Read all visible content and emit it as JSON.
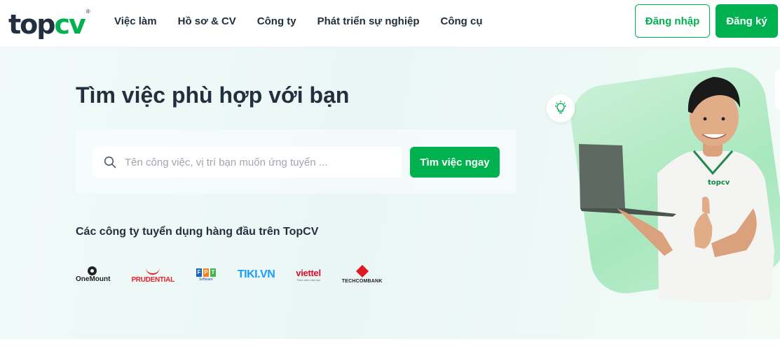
{
  "brand": {
    "logo_left": "top",
    "logo_right": "cv",
    "registered": "®",
    "accent": "#00b14f",
    "dark": "#212f3f"
  },
  "nav": {
    "items": [
      "Việc làm",
      "Hồ sơ & CV",
      "Công ty",
      "Phát triển sự nghiệp",
      "Công cụ"
    ]
  },
  "auth": {
    "login": "Đăng nhập",
    "register": "Đăng ký"
  },
  "hero": {
    "title": "Tìm việc phù hợp với bạn",
    "search_placeholder": "Tên công việc, vị trí bạn muốn ứng tuyển ...",
    "search_value": "",
    "search_button": "Tìm việc ngay"
  },
  "companies": {
    "title": "Các công ty tuyển dụng hàng đầu trên TopCV",
    "logos": {
      "onemount": "OneMount",
      "prudential": "PRUDENTIAL",
      "fpt": [
        "F",
        "P",
        "T"
      ],
      "fpt_sub": "Software",
      "tiki": "TIKI.VN",
      "viettel": "viettel",
      "viettel_sub": "Theo cách của bạn",
      "techcombank": "TECHCOMBANK"
    }
  },
  "illustration": {
    "shirt_logo": "topcv",
    "icons": [
      "lightbulb-icon",
      "search-icon"
    ]
  }
}
